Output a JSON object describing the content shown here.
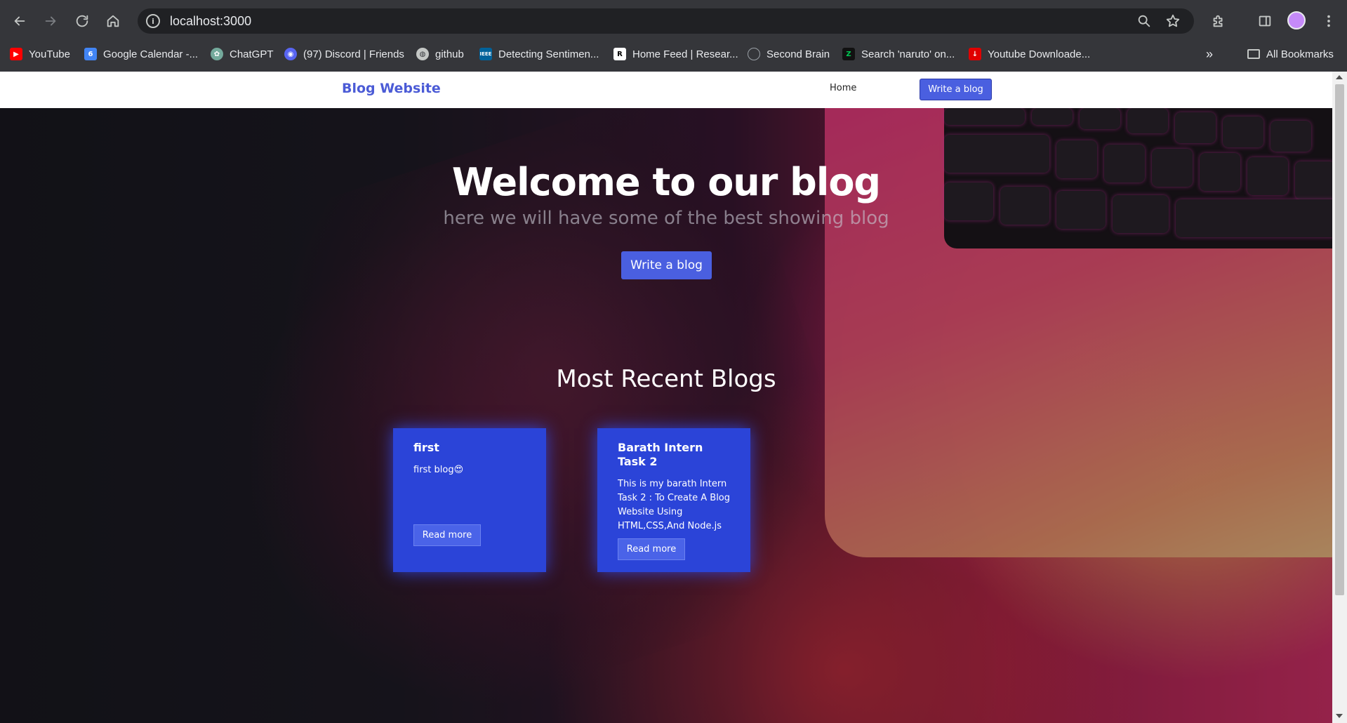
{
  "browser": {
    "url": "localhost:3000",
    "bookmarks": [
      {
        "label": "YouTube",
        "icon": "youtube-icon",
        "color": "#ff0000"
      },
      {
        "label": "Google Calendar -...",
        "icon": "google-calendar-icon",
        "color": "#4285f4"
      },
      {
        "label": "ChatGPT",
        "icon": "chatgpt-icon",
        "color": "#74aa9c"
      },
      {
        "label": "(97) Discord | Friends",
        "icon": "discord-icon",
        "color": "#5865f2"
      },
      {
        "label": "github",
        "icon": "github-icon",
        "color": "#c4c7c5"
      },
      {
        "label": "Detecting Sentimen...",
        "icon": "ieee-icon",
        "color": "#00629b"
      },
      {
        "label": "Home Feed | Resear...",
        "icon": "researchgate-icon",
        "color": "#ffffff"
      },
      {
        "label": "Second Brain",
        "icon": "brain-icon",
        "color": "#9aa0a6"
      },
      {
        "label": "Search 'naruto' on...",
        "icon": "z-icon",
        "color": "#00c853"
      },
      {
        "label": "Youtube Downloade...",
        "icon": "download-icon",
        "color": "#e00000"
      }
    ],
    "all_bookmarks_label": "All Bookmarks"
  },
  "site": {
    "brand": "Blog Website",
    "nav_home": "Home",
    "nav_write": "Write a blog",
    "accent": "#4a5fe0"
  },
  "hero": {
    "title": "Welcome to our blog",
    "subtitle": "here we will have some of the best showing blog",
    "button": "Write a blog"
  },
  "recent": {
    "title": "Most Recent Blogs",
    "cards": [
      {
        "title": "first",
        "body": "first blog😍",
        "button": "Read more"
      },
      {
        "title": "Barath Intern Task 2",
        "body": "This is my barath Intern Task 2 : To Create A Blog Website Using HTML,CSS,And Node.js",
        "button": "Read more"
      }
    ]
  }
}
